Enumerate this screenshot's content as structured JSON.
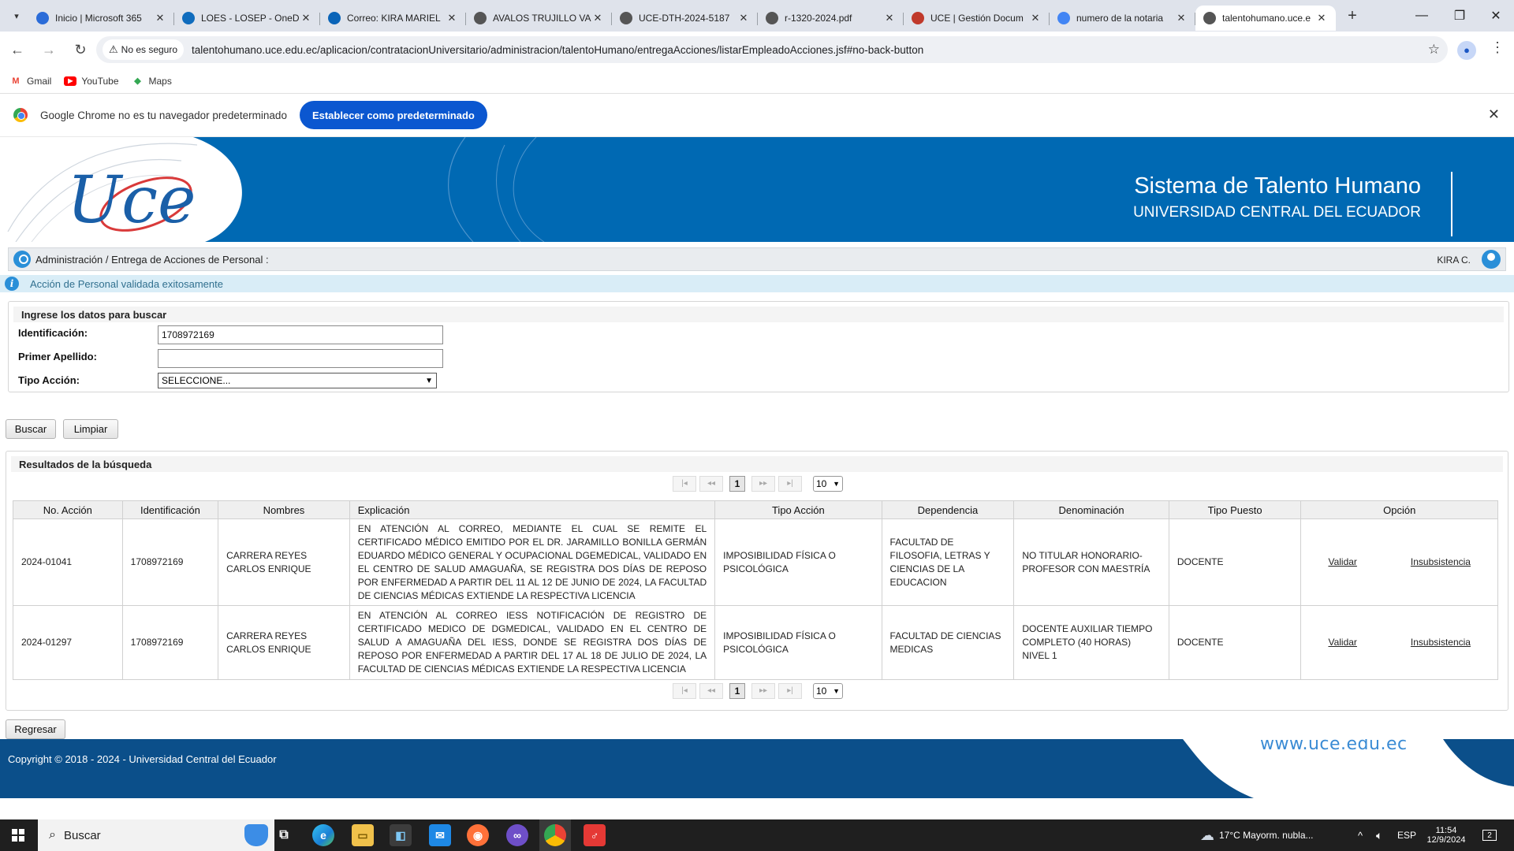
{
  "browser": {
    "tabs": [
      {
        "title": "Inicio | Microsoft 365",
        "icon": "m365-icon",
        "color": "#2b6cd8"
      },
      {
        "title": "LOES - LOSEP - OneD",
        "icon": "onedrive-icon",
        "color": "#0f6cbd"
      },
      {
        "title": "Correo: KIRA MARIEL",
        "icon": "outlook-icon",
        "color": "#0a64b8"
      },
      {
        "title": "AVALOS TRUJILLO VA",
        "icon": "globe-icon",
        "color": "#555555"
      },
      {
        "title": "UCE-DTH-2024-5187",
        "icon": "globe-icon",
        "color": "#555555"
      },
      {
        "title": "r-1320-2024.pdf",
        "icon": "globe-icon",
        "color": "#555555"
      },
      {
        "title": "UCE | Gestión Docum",
        "icon": "quipux-icon",
        "color": "#c0392b"
      },
      {
        "title": "numero de la notaria",
        "icon": "google-icon",
        "color": "#4285f4"
      },
      {
        "title": "talentohumano.uce.e",
        "icon": "loading-icon",
        "color": "#555555"
      }
    ],
    "not_secure_label": "No es seguro",
    "url": "talentohumano.uce.edu.ec/aplicacion/contratacionUniversitario/administracion/talentoHumano/entregaAcciones/listarEmpleadoAcciones.jsf#no-back-button",
    "bookmarks": [
      {
        "label": "Gmail",
        "icon": "gmail-icon"
      },
      {
        "label": "YouTube",
        "icon": "youtube-icon"
      },
      {
        "label": "Maps",
        "icon": "maps-icon"
      }
    ],
    "infobar_text": "Google Chrome no es tu navegador predeterminado",
    "infobar_button": "Establecer como predeterminado"
  },
  "header": {
    "system_title": "Sistema de Talento Humano",
    "university": "UNIVERSIDAD CENTRAL DEL ECUADOR",
    "logo_text": "Uce"
  },
  "breadcrumb": {
    "text": "Administración / Entrega de Acciones de Personal :",
    "user": "KIRA C."
  },
  "message": "Acción de Personal validada exitosamente",
  "search": {
    "title": "Ingrese los datos para buscar",
    "id_label": "Identificación:",
    "id_value": "1708972169",
    "lastname_label": "Primer Apellido:",
    "lastname_value": "",
    "action_label": "Tipo Acción:",
    "action_value": "SELECCIONE...",
    "search_button": "Buscar",
    "clear_button": "Limpiar"
  },
  "results": {
    "title": "Resultados de la búsqueda",
    "current_page": "1",
    "rows_per_page": "10",
    "columns": [
      "No. Acción",
      "Identificación",
      "Nombres",
      "Explicación",
      "Tipo Acción",
      "Dependencia",
      "Denominación",
      "Tipo Puesto",
      "Opción"
    ],
    "validate_label": "Validar",
    "insub_label": "Insubsistencia",
    "rows": [
      {
        "action_no": "2024-01041",
        "id": "1708972169",
        "name": "CARRERA REYES CARLOS ENRIQUE",
        "explanation": "EN ATENCIÓN AL CORREO, MEDIANTE EL CUAL SE REMITE EL CERTIFICADO MÉDICO EMITIDO POR EL DR. JARAMILLO BONILLA GERMÁN EDUARDO MÉDICO GENERAL Y OCUPACIONAL DGEMEDICAL, VALIDADO EN EL CENTRO DE SALUD AMAGUAÑA, SE REGISTRA DOS DÍAS DE REPOSO POR ENFERMEDAD A PARTIR DEL 11 AL 12 DE JUNIO DE 2024, LA FACULTAD DE CIENCIAS MÉDICAS EXTIENDE LA RESPECTIVA LICENCIA",
        "action_type": "IMPOSIBILIDAD FÍSICA O PSICOLÓGICA",
        "dependency": "FACULTAD DE FILOSOFIA, LETRAS Y CIENCIAS DE LA EDUCACION",
        "denomination": "NO TITULAR HONORARIO-PROFESOR CON MAESTRÍA",
        "position_type": "DOCENTE"
      },
      {
        "action_no": "2024-01297",
        "id": "1708972169",
        "name": "CARRERA REYES CARLOS ENRIQUE",
        "explanation": "EN ATENCIÓN AL CORREO IESS NOTIFICACIÓN DE REGISTRO DE CERTIFICADO MEDICO DE DGMEDICAL, VALIDADO EN EL CENTRO DE SALUD A AMAGUAÑA DEL IESS, DONDE SE REGISTRA DOS DÍAS DE REPOSO POR ENFERMEDAD A PARTIR DEL 17 AL 18 DE JULIO DE 2024, LA FACULTAD DE CIENCIAS MÉDICAS EXTIENDE LA RESPECTIVA LICENCIA",
        "action_type": "IMPOSIBILIDAD FÍSICA O PSICOLÓGICA",
        "dependency": "FACULTAD DE CIENCIAS MEDICAS",
        "denomination": "DOCENTE AUXILIAR TIEMPO COMPLETO (40 HORAS) NIVEL 1",
        "position_type": "DOCENTE"
      }
    ]
  },
  "back_button": "Regresar",
  "footer": {
    "copyright": "Copyright © 2018 - 2024 - Universidad Central del Ecuador",
    "website": "www.uce.edu.ec"
  },
  "taskbar": {
    "search_placeholder": "Buscar",
    "weather": "17°C  Mayorm. nubla...",
    "language": "ESP",
    "time": "11:54",
    "date": "12/9/2024",
    "notifications": "2"
  },
  "colors": {
    "banner": "#0069b3",
    "footer": "#0b4f8a",
    "accent_button": "#0b57d0",
    "message_bg": "#d9edf7"
  }
}
